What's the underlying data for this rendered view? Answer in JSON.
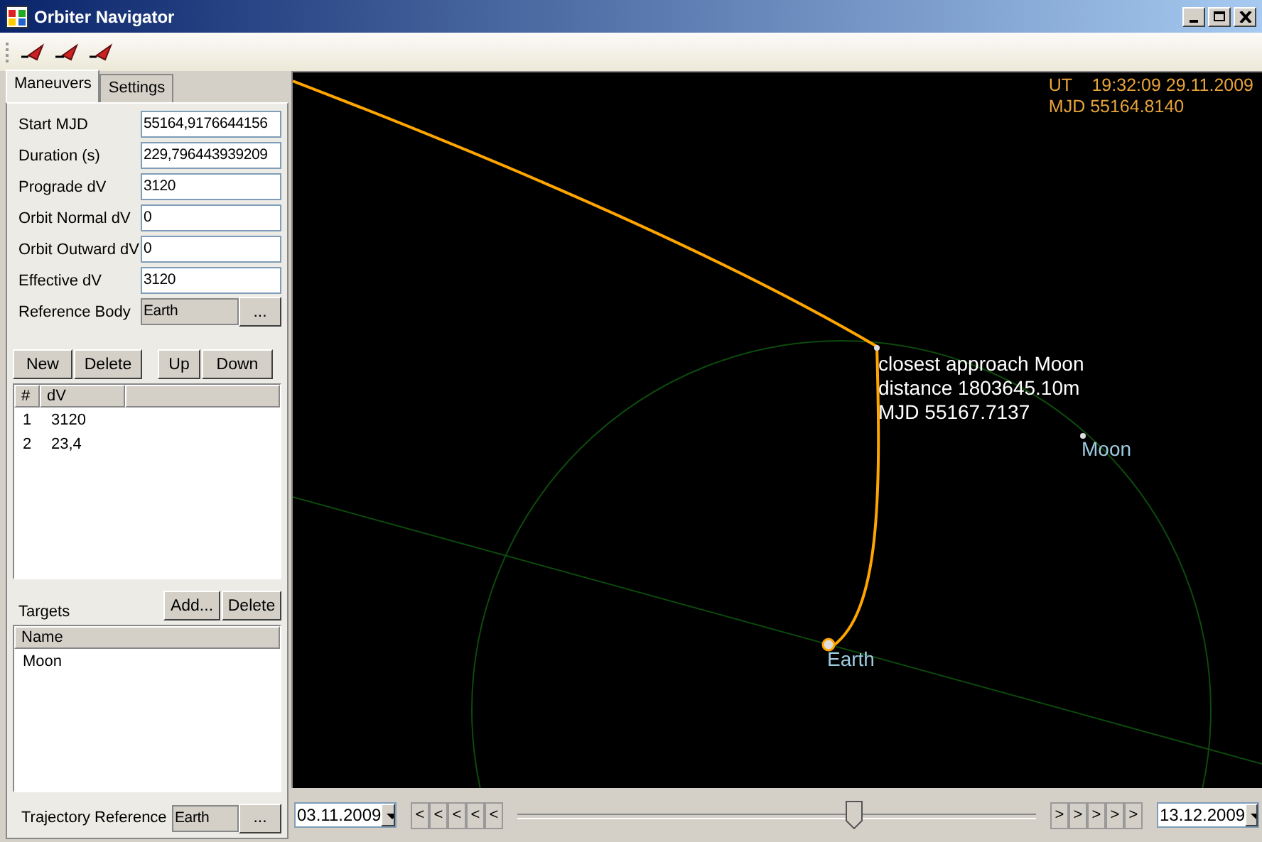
{
  "window": {
    "title": "Orbiter Navigator"
  },
  "tabs": [
    {
      "label": "Maneuvers",
      "selected": true
    },
    {
      "label": "Settings",
      "selected": false
    }
  ],
  "maneuver_fields": [
    {
      "label": "Start MJD",
      "value": "55164,9176644156"
    },
    {
      "label": "Duration (s)",
      "value": "229,796443939209"
    },
    {
      "label": "Prograde dV",
      "value": "3120"
    },
    {
      "label": "Orbit Normal dV",
      "value": "0"
    },
    {
      "label": "Orbit Outward dV",
      "value": "0"
    },
    {
      "label": "Effective dV",
      "value": "3120"
    }
  ],
  "reference_body": {
    "label": "Reference Body",
    "value": "Earth",
    "button": "..."
  },
  "maneuver_buttons": [
    "New",
    "Delete",
    "Up",
    "Down"
  ],
  "maneuver_table": {
    "columns": [
      "#",
      "dV"
    ],
    "rows": [
      [
        "1",
        "3120"
      ],
      [
        "2",
        "23,4"
      ]
    ]
  },
  "targets": {
    "label": "Targets",
    "buttons": [
      "Add...",
      "Delete"
    ],
    "columns": [
      "Name"
    ],
    "rows": [
      "Moon"
    ]
  },
  "trajectory_reference": {
    "label": "Trajectory Reference",
    "value": "Earth",
    "button": "..."
  },
  "view": {
    "ut": "UT    19:32:09 29.11.2009",
    "mjd": "MJD 55164.8140",
    "annotation": [
      "closest approach Moon",
      "distance 1803645.10m",
      "MJD 55167.7137"
    ],
    "bodies": [
      "Moon",
      "Earth"
    ]
  },
  "timeline": {
    "start": "03.11.2009",
    "end": "13.12.2009",
    "back": [
      "<",
      "<",
      "<",
      "<",
      "<"
    ],
    "forward": [
      ">",
      ">",
      ">",
      ">",
      ">"
    ],
    "level": 0.65
  }
}
